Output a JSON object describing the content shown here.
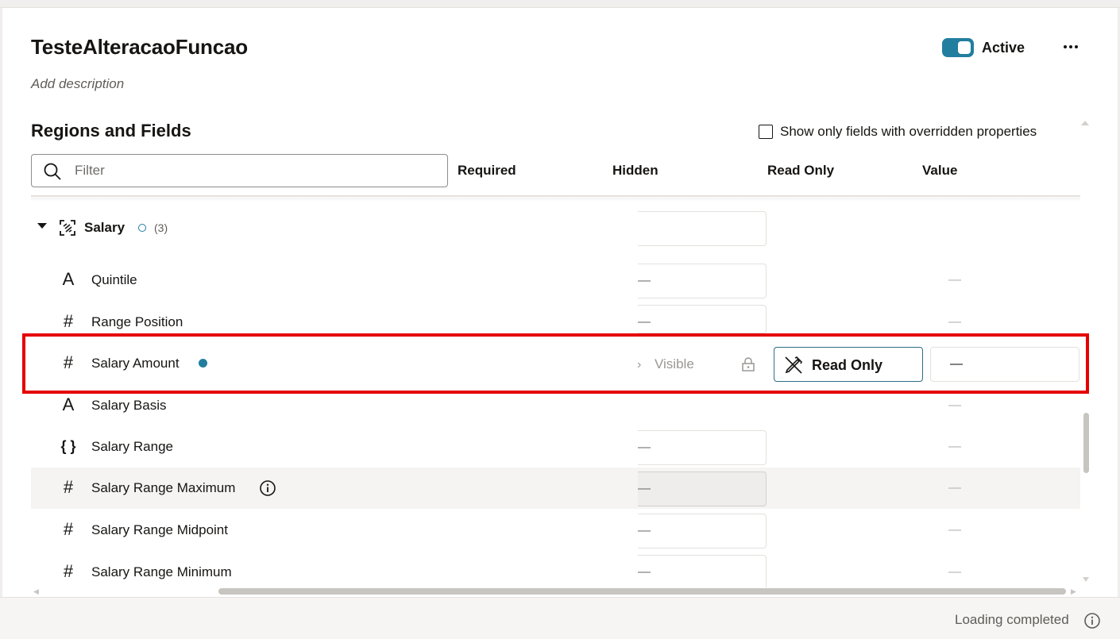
{
  "page": {
    "title": "TesteAlteracaoFuncao",
    "description_placeholder": "Add description",
    "status_label": "Active",
    "status_active": true,
    "more_icon": "ellipsis-icon"
  },
  "section": {
    "title": "Regions and Fields",
    "override_filter_label": "Show only fields with overridden properties",
    "override_filter_checked": false,
    "filter_placeholder": "Filter",
    "columns": [
      "Required",
      "Hidden",
      "Read Only",
      "Value"
    ]
  },
  "group": {
    "name": "Salary",
    "count": "(3)",
    "icon": "region-icon"
  },
  "rows": [
    {
      "name": "Quintile",
      "icon": "text-type-icon",
      "glyph": "A",
      "hidden": "—",
      "value": "—"
    },
    {
      "name": "Range Position",
      "icon": "number-type-icon",
      "glyph": "#",
      "hidden": "—",
      "value": "—"
    },
    {
      "name": "Salary Amount",
      "icon": "number-type-icon",
      "glyph": "#",
      "hidden_state": "Visible",
      "read_only": "Read Only",
      "value": "—",
      "selected": true
    },
    {
      "name": "Salary Basis",
      "icon": "text-type-icon",
      "glyph": "A",
      "value": "—"
    },
    {
      "name": "Salary Range",
      "icon": "object-type-icon",
      "glyph": "{ }",
      "hidden": "—",
      "value": "—"
    },
    {
      "name": "Salary Range Maximum",
      "icon": "number-type-icon",
      "glyph": "#",
      "hidden": "—",
      "value": "—",
      "highlighted": true
    },
    {
      "name": "Salary Range Midpoint",
      "icon": "number-type-icon",
      "glyph": "#",
      "hidden": "—",
      "value": "—"
    },
    {
      "name": "Salary Range Minimum",
      "icon": "number-type-icon",
      "glyph": "#",
      "hidden": "—",
      "value": "—"
    }
  ],
  "footer": {
    "status": "Loading completed",
    "icon": "info-icon"
  },
  "colors": {
    "accent": "#227e9e",
    "selection_outline": "#e50000"
  }
}
